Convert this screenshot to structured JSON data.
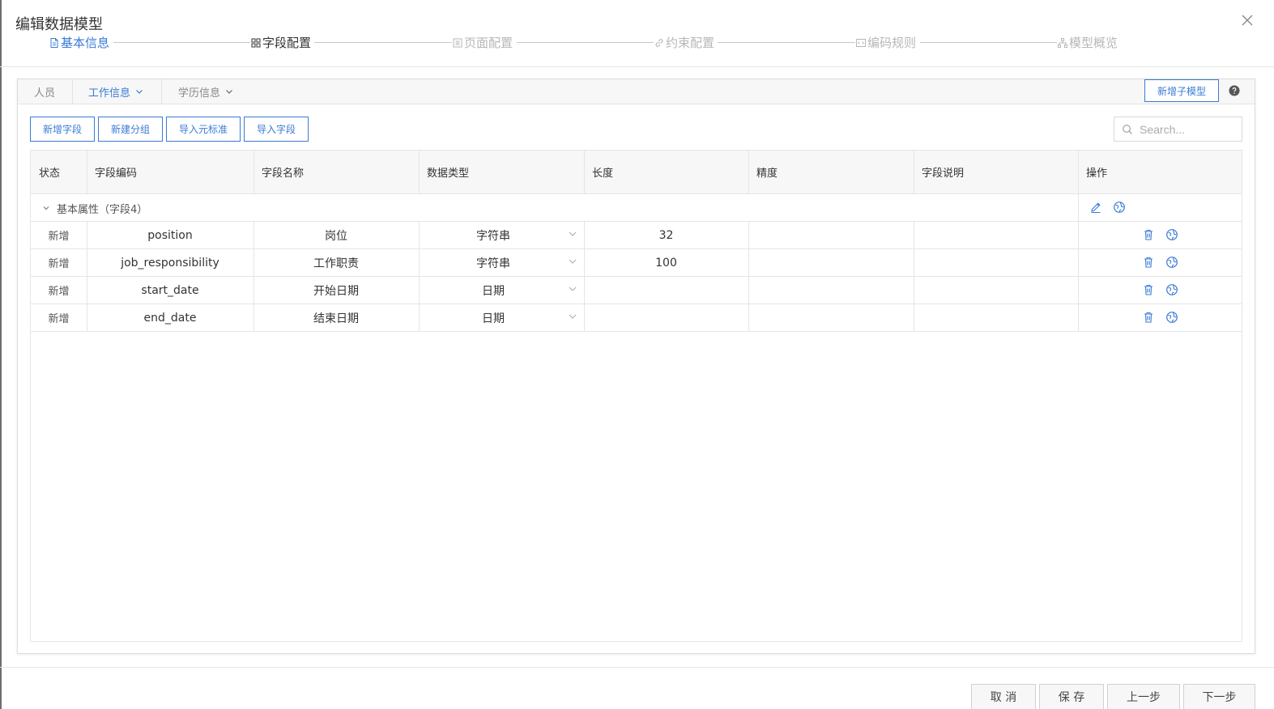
{
  "dialog": {
    "title": "编辑数据模型"
  },
  "steps": [
    {
      "label": "基本信息",
      "state": "done"
    },
    {
      "label": "字段配置",
      "state": "active"
    },
    {
      "label": "页面配置",
      "state": "todo"
    },
    {
      "label": "约束配置",
      "state": "todo"
    },
    {
      "label": "编码规则",
      "state": "todo"
    },
    {
      "label": "模型概览",
      "state": "todo"
    }
  ],
  "tabs": [
    {
      "label": "人员"
    },
    {
      "label": "工作信息"
    },
    {
      "label": "学历信息"
    }
  ],
  "add_submodel_label": "新增子模型",
  "toolbar": {
    "add_field": "新增字段",
    "add_group": "新建分组",
    "import_meta": "导入元标准",
    "import_field": "导入字段"
  },
  "search": {
    "placeholder": "Search..."
  },
  "table": {
    "columns": [
      "状态",
      "字段编码",
      "字段名称",
      "数据类型",
      "长度",
      "精度",
      "字段说明",
      "操作"
    ],
    "group": {
      "label": "基本属性（字段4）"
    },
    "rows": [
      {
        "status": "新增",
        "code": "position",
        "name": "岗位",
        "type": "字符串",
        "length": "32",
        "precision": "",
        "desc": ""
      },
      {
        "status": "新增",
        "code": "job_responsibility",
        "name": "工作职责",
        "type": "字符串",
        "length": "100",
        "precision": "",
        "desc": ""
      },
      {
        "status": "新增",
        "code": "start_date",
        "name": "开始日期",
        "type": "日期",
        "length": "",
        "precision": "",
        "desc": ""
      },
      {
        "status": "新增",
        "code": "end_date",
        "name": "结束日期",
        "type": "日期",
        "length": "",
        "precision": "",
        "desc": ""
      }
    ]
  },
  "footer": {
    "cancel": "取 消",
    "save": "保 存",
    "prev": "上一步",
    "next": "下一步"
  },
  "colors": {
    "accent": "#3a7bd5",
    "muted": "#b7b7b7"
  }
}
